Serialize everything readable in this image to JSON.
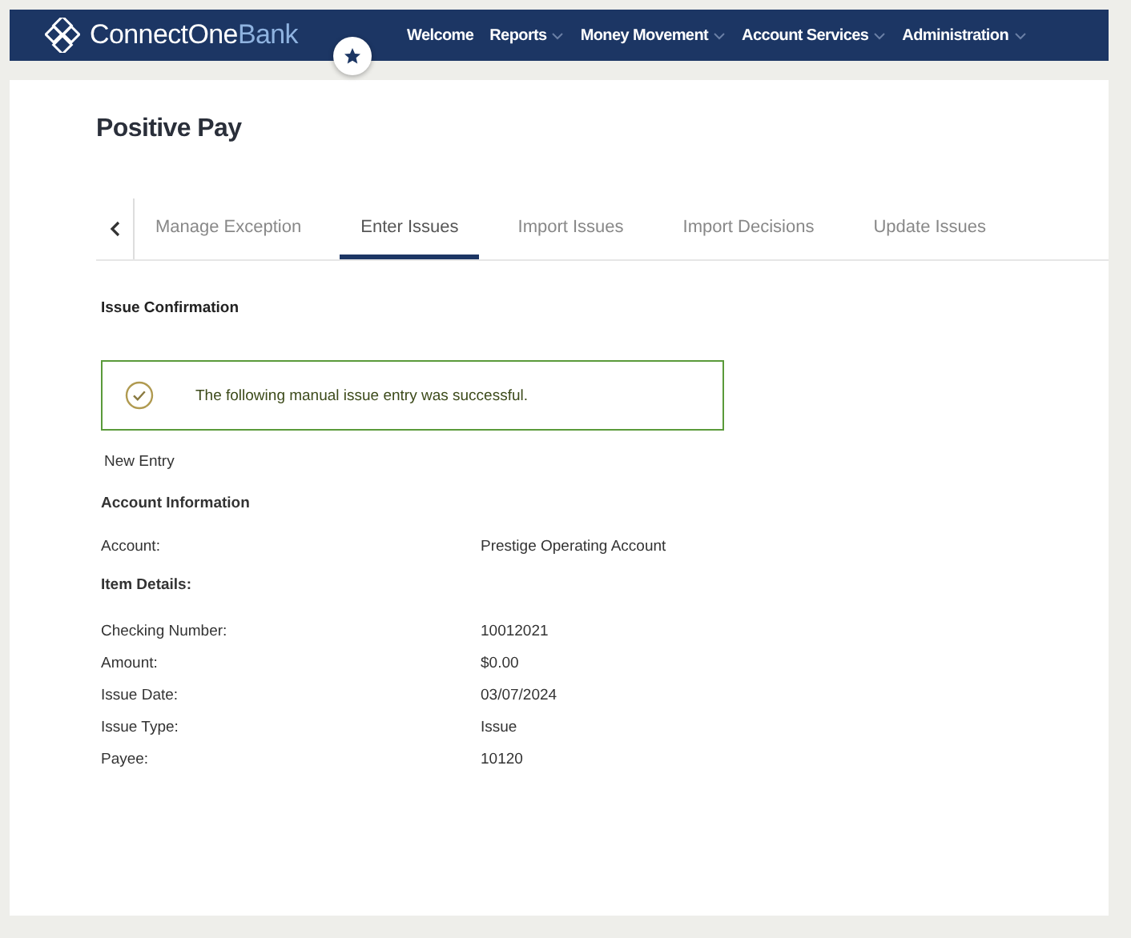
{
  "header": {
    "logo": {
      "name": "ConnectOne",
      "accent": "Bank"
    },
    "nav": [
      {
        "label": "Welcome",
        "has_menu": false
      },
      {
        "label": "Reports",
        "has_menu": true
      },
      {
        "label": "Money Movement",
        "has_menu": true
      },
      {
        "label": "Account Services",
        "has_menu": true
      },
      {
        "label": "Administration",
        "has_menu": true
      }
    ]
  },
  "page": {
    "title": "Positive Pay",
    "tabs": [
      {
        "label": "Manage Exception",
        "selected": false
      },
      {
        "label": "Enter Issues",
        "selected": true
      },
      {
        "label": "Import Issues",
        "selected": false
      },
      {
        "label": "Import Decisions",
        "selected": false
      },
      {
        "label": "Update Issues",
        "selected": false
      }
    ],
    "section_title": "Issue Confirmation",
    "alert": {
      "kind": "success",
      "message": "The following manual issue entry was successful."
    },
    "new_entry_link": "New Entry",
    "account_information": {
      "title": "Account Information",
      "rows": [
        {
          "label": "Account:",
          "value": "Prestige Operating Account"
        }
      ]
    },
    "item_details": {
      "title": "Item Details:",
      "rows": [
        {
          "label": "Checking Number:",
          "value": "10012021"
        },
        {
          "label": "Amount:",
          "value": "$0.00"
        },
        {
          "label": "Issue Date:",
          "value": "03/07/2024"
        },
        {
          "label": "Issue Type:",
          "value": "Issue"
        },
        {
          "label": "Payee:",
          "value": "10120"
        }
      ]
    }
  }
}
